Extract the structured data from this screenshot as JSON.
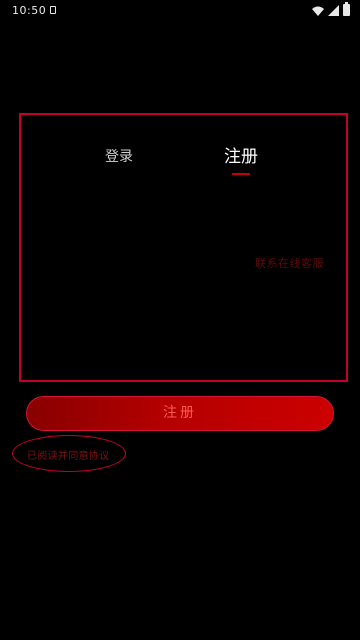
{
  "status_bar": {
    "time": "10:50"
  },
  "auth": {
    "tabs": [
      {
        "label": "登录",
        "active": false
      },
      {
        "label": "注册",
        "active": true
      }
    ],
    "side_link_label": "联系在线客服",
    "accent_color": "#c80000"
  },
  "submit_button_label": "注册",
  "agreement_label": "已阅读并同意协议"
}
